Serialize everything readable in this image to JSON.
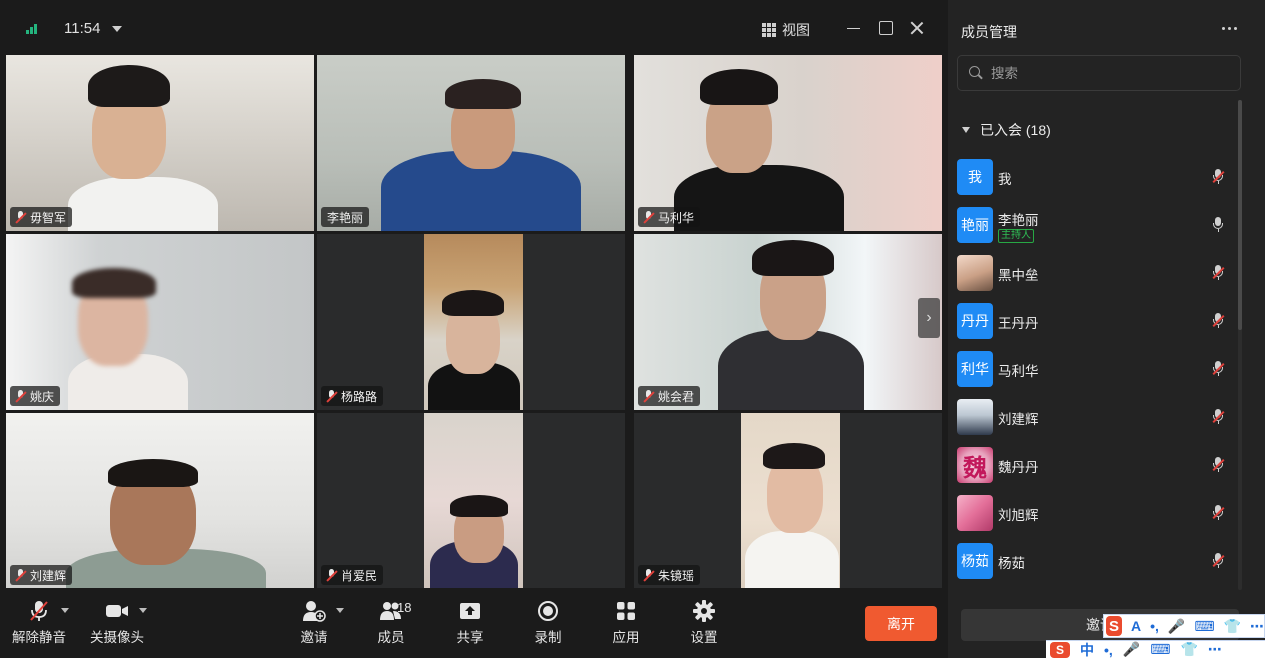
{
  "topbar": {
    "time": "11:54",
    "view_label": "视图"
  },
  "tiles": [
    {
      "name": "毋智军",
      "muted": true
    },
    {
      "name": "李艳丽",
      "muted": false,
      "speaking": true
    },
    {
      "name": "马利华",
      "muted": true
    },
    {
      "name": "姚庆",
      "muted": true
    },
    {
      "name": "杨路路",
      "muted": true
    },
    {
      "name": "姚会君",
      "muted": true
    },
    {
      "name": "刘建辉",
      "muted": true
    },
    {
      "name": "肖爱民",
      "muted": true
    },
    {
      "name": "朱镜瑶",
      "muted": true
    }
  ],
  "toolbar": {
    "unmute_label": "解除静音",
    "camera_label": "关摄像头",
    "invite_label": "邀请",
    "members_label": "成员",
    "members_count": "18",
    "share_label": "共享",
    "record_label": "录制",
    "apps_label": "应用",
    "settings_label": "设置",
    "leave_label": "离开"
  },
  "panel": {
    "title": "成员管理",
    "search_placeholder": "搜索",
    "section_label": "已入会 (18)",
    "invite_label": "邀请",
    "members": [
      {
        "avatar": "我",
        "name": "我",
        "muted": true
      },
      {
        "avatar": "艳丽",
        "name": "李艳丽",
        "badge": "主持人",
        "muted": false
      },
      {
        "avatar": "",
        "name": "黑中垒",
        "muted": true,
        "photo": "photo-a"
      },
      {
        "avatar": "丹丹",
        "name": "王丹丹",
        "muted": true
      },
      {
        "avatar": "利华",
        "name": "马利华",
        "muted": true
      },
      {
        "avatar": "",
        "name": "刘建辉",
        "muted": true,
        "photo": "photo-b"
      },
      {
        "avatar": "魏",
        "name": "魏丹丹",
        "muted": true,
        "photo": "photo-c"
      },
      {
        "avatar": "",
        "name": "刘旭辉",
        "muted": true,
        "photo": "photo-d"
      },
      {
        "avatar": "杨茹",
        "name": "杨茹",
        "muted": true
      }
    ]
  },
  "ime": {
    "logo": "S",
    "row1": [
      "A",
      "•,",
      "🎤",
      "⌨",
      "👕",
      "⋯"
    ],
    "row2": [
      "中",
      "•,",
      "🎤",
      "⌨",
      "👕",
      "⋯"
    ]
  },
  "colors": {
    "accent_blue": "#1f8bf5",
    "leave_orange": "#f05a30",
    "active_speaker": "#2aa74a",
    "mute_red": "#e0413b"
  }
}
